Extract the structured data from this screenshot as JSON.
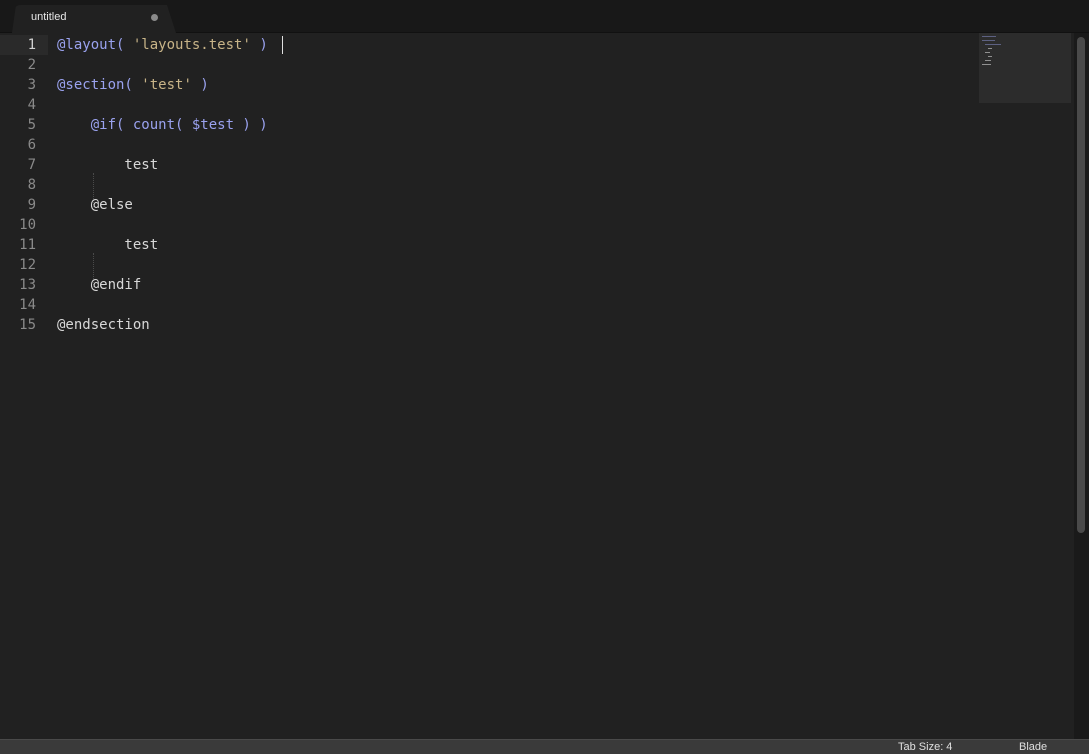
{
  "tabs": [
    {
      "label": "untitled",
      "dirty": true
    }
  ],
  "editor": {
    "line_numbers": [
      "1",
      "2",
      "3",
      "4",
      "5",
      "6",
      "7",
      "8",
      "9",
      "10",
      "11",
      "12",
      "13",
      "14",
      "15"
    ],
    "current_line": 1,
    "lines": [
      [
        {
          "t": "kw",
          "v": "@layout("
        },
        {
          "t": "plain",
          "v": " "
        },
        {
          "t": "str",
          "v": "'layouts.test'"
        },
        {
          "t": "plain",
          "v": " "
        },
        {
          "t": "kw",
          "v": ")"
        }
      ],
      [],
      [
        {
          "t": "kw",
          "v": "@section("
        },
        {
          "t": "plain",
          "v": " "
        },
        {
          "t": "str",
          "v": "'test'"
        },
        {
          "t": "plain",
          "v": " "
        },
        {
          "t": "kw",
          "v": ")"
        }
      ],
      [],
      [
        {
          "t": "plain",
          "v": "    "
        },
        {
          "t": "kw",
          "v": "@if( count( $test ) )"
        }
      ],
      [],
      [
        {
          "t": "plain",
          "v": "        test"
        }
      ],
      [],
      [
        {
          "t": "plain",
          "v": "    @else"
        }
      ],
      [],
      [
        {
          "t": "plain",
          "v": "        test"
        }
      ],
      [],
      [
        {
          "t": "plain",
          "v": "    @endif"
        }
      ],
      [],
      [
        {
          "t": "plain",
          "v": "@endsection"
        }
      ]
    ]
  },
  "status": {
    "tab_size": "Tab Size: 4",
    "syntax": "Blade"
  }
}
